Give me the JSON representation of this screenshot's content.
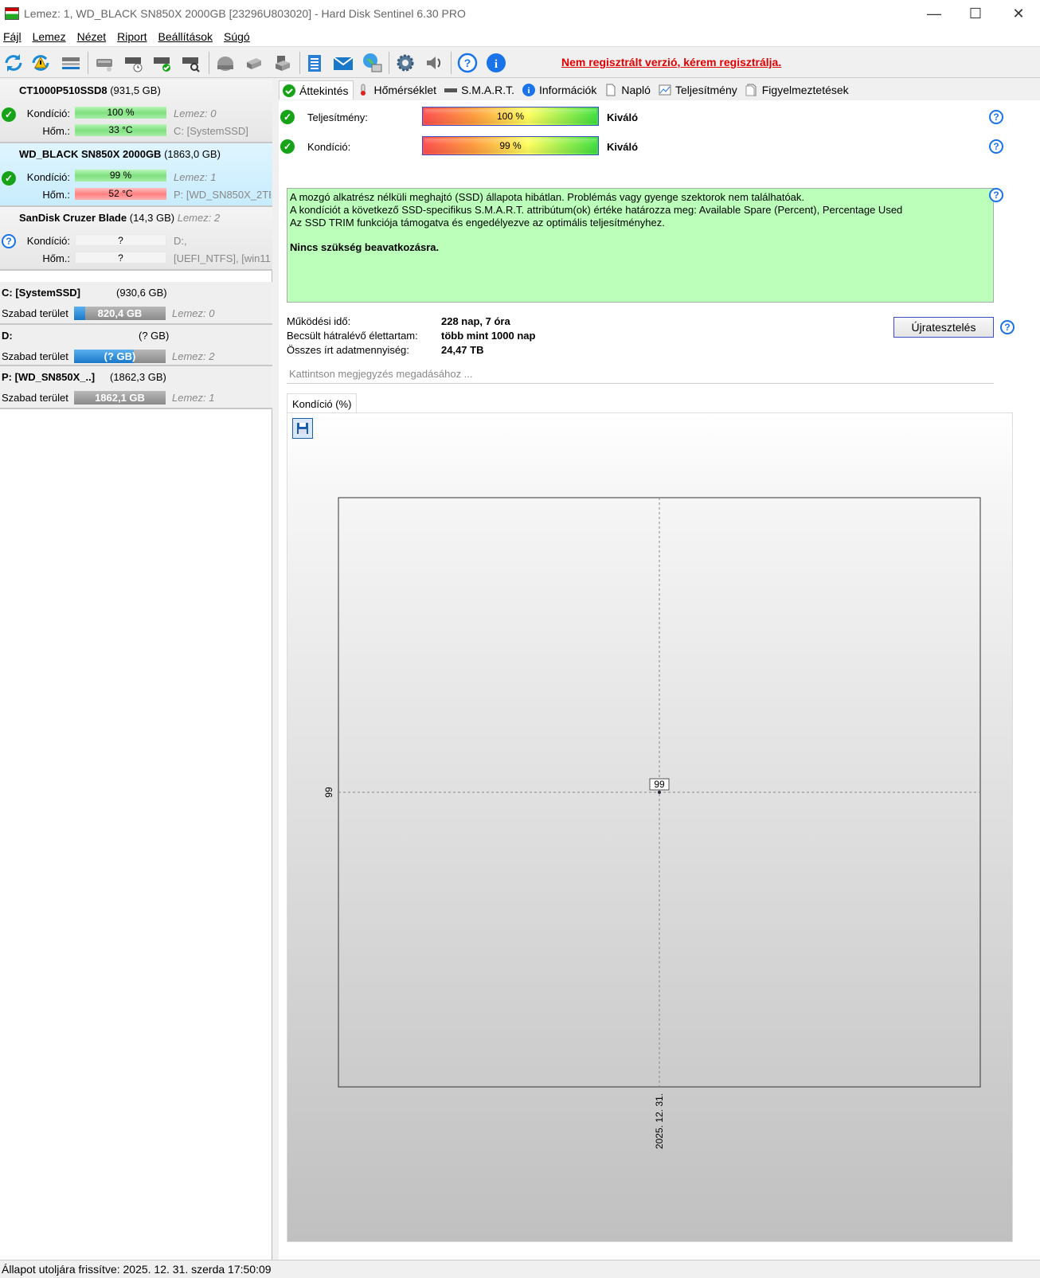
{
  "window": {
    "title": "Lemez: 1, WD_BLACK SN850X 2000GB [23296U803020]  -  Hard Disk Sentinel 6.30 PRO",
    "minimize": "—",
    "maximize": "☐",
    "close": "✕"
  },
  "menu": [
    {
      "label": "Fájl"
    },
    {
      "label": "Lemez"
    },
    {
      "label": "Nézet"
    },
    {
      "label": "Riport"
    },
    {
      "label": "Beállítások"
    },
    {
      "label": "Súgó"
    }
  ],
  "toolbar": {
    "unregistered": "Nem regisztrált verzió, kérem regisztrálja."
  },
  "disks": [
    {
      "name": "CT1000P510SSD8",
      "size": "(931,5 GB)",
      "status": "ok",
      "condition_label": "Kondíció:",
      "condition_value": "100 %",
      "condition_pct": 100,
      "condition_meta": "Lemez: 0",
      "temp_label": "Hőm.:",
      "temp_value": "33 °C",
      "temp_meta": "C: [SystemSSD]"
    },
    {
      "name": "WD_BLACK SN850X 2000GB",
      "size": "(1863,0 GB)",
      "status": "ok",
      "condition_label": "Kondíció:",
      "condition_value": "99 %",
      "condition_pct": 99,
      "condition_meta": "Lemez: 1",
      "temp_label": "Hőm.:",
      "temp_value": "52 °C",
      "temp_meta": "P: [WD_SN850X_2TB]"
    },
    {
      "name": "SanDisk Cruzer Blade",
      "size": "(14,3 GB)",
      "disk_meta": "Lemez: 2",
      "status": "unknown",
      "condition_label": "Kondíció:",
      "condition_value": "?",
      "condition_meta": "D:,",
      "temp_label": "Hőm.:",
      "temp_value": "?",
      "temp_meta": "[UEFI_NTFS],  [win11"
    }
  ],
  "volumes": [
    {
      "name": "C: [SystemSSD]",
      "size": "(930,6 GB)",
      "free_label": "Szabad terület",
      "free_value": "820,4 GB",
      "free_fraction": 0.12,
      "disk": "Lemez: 0"
    },
    {
      "name": "D:",
      "size": "(? GB)",
      "free_label": "Szabad terület",
      "free_value": "(? GB)",
      "free_fraction": 0.65,
      "disk": "Lemez: 2"
    },
    {
      "name": "P: [WD_SN850X_..]",
      "size": "(1862,3 GB)",
      "free_label": "Szabad terület",
      "free_value": "1862,1 GB",
      "free_fraction": 0.0,
      "disk": "Lemez: 1"
    }
  ],
  "tabs": [
    {
      "label": "Áttekintés",
      "icon": "check-icon"
    },
    {
      "label": "Hőmérséklet",
      "icon": "thermometer-icon"
    },
    {
      "label": "S.M.A.R.T.",
      "icon": "disk-icon"
    },
    {
      "label": "Információk",
      "icon": "info-icon"
    },
    {
      "label": "Napló",
      "icon": "document-icon"
    },
    {
      "label": "Teljesítmény",
      "icon": "chart-icon"
    },
    {
      "label": "Figyelmeztetések",
      "icon": "warning-doc-icon"
    }
  ],
  "overview": {
    "performance_label": "Teljesítmény:",
    "performance_value": "100 %",
    "performance_status": "Kiváló",
    "condition_label": "Kondíció:",
    "condition_value": "99 %",
    "condition_status": "Kiváló",
    "message_lines": [
      "A mozgó alkatrész nélküli meghajtó (SSD) állapota hibátlan. Problémás vagy gyenge szektorok nem találhatóak.",
      "A kondíciót a következő SSD-specifikus S.M.A.R.T. attribútum(ok) értéke határozza meg:  Available Spare (Percent), Percentage Used",
      "Az SSD TRIM funkciója támogatva és engedélyezve az optimális teljesítményhez."
    ],
    "message_action": "Nincs szükség beavatkozásra.",
    "uptime_label": "Működési idő:",
    "uptime_value": "228 nap, 7 óra",
    "lifetime_label": "Becsült hátralévő élettartam:",
    "lifetime_value": "több mint 1000 nap",
    "written_label": "Összes írt adatmennyiség:",
    "written_value": "24,47 TB",
    "retest_button": "Újratesztelés",
    "note_placeholder": "Kattintson megjegyzés megadásához ...",
    "chart_tab": "Kondíció  (%)"
  },
  "chart_data": {
    "type": "line",
    "x": [
      "2025. 12. 31."
    ],
    "series": [
      {
        "values": [
          99
        ]
      }
    ],
    "ytick": "99",
    "data_label": "99"
  },
  "statusbar": "Állapot utoljára frissítve: 2025. 12. 31. szerda 17:50:09",
  "colors": {
    "accent": "#1a73e8",
    "ok": "#17a317",
    "unregistered": "#e00000",
    "message_bg": "#bbffbb"
  }
}
